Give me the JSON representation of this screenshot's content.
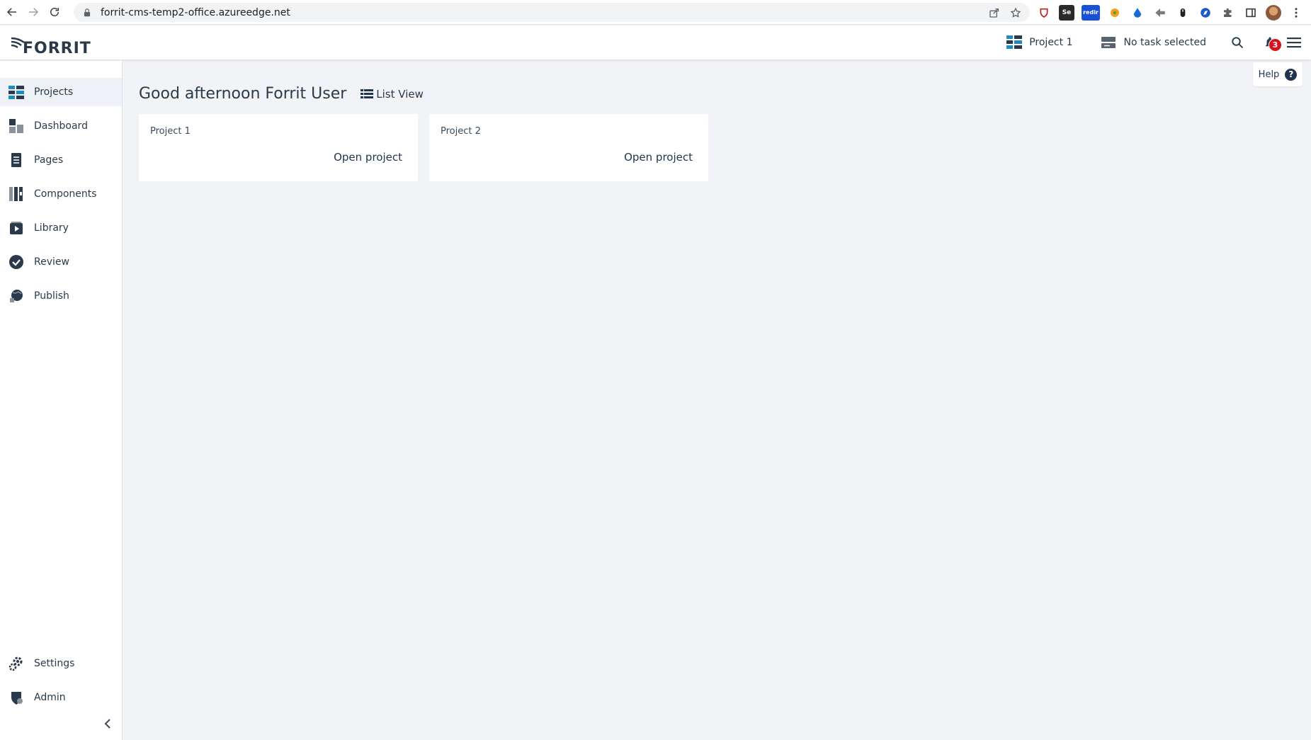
{
  "browser": {
    "url": "forrit-cms-temp2-office.azureedge.net",
    "ext_badge": "redir",
    "ext_se": "Se"
  },
  "header": {
    "logo": "FORRIT",
    "project_label": "Project 1",
    "task_label": "No task selected",
    "notifications_count": "3"
  },
  "sidebar": {
    "items": [
      {
        "label": "Projects"
      },
      {
        "label": "Dashboard"
      },
      {
        "label": "Pages"
      },
      {
        "label": "Components"
      },
      {
        "label": "Library"
      },
      {
        "label": "Review"
      },
      {
        "label": "Publish"
      }
    ],
    "bottom_items": [
      {
        "label": "Settings"
      },
      {
        "label": "Admin"
      }
    ]
  },
  "main": {
    "greeting": "Good afternoon Forrit User",
    "list_view_label": "List View",
    "help_label": "Help",
    "help_glyph": "?",
    "projects": [
      {
        "name": "Project 1",
        "action": "Open project"
      },
      {
        "name": "Project 2",
        "action": "Open project"
      }
    ]
  },
  "colors": {
    "accent": "#1f8ac0",
    "text": "#2a3a4a",
    "badge": "#d6121f",
    "background": "#f2f3f6"
  }
}
